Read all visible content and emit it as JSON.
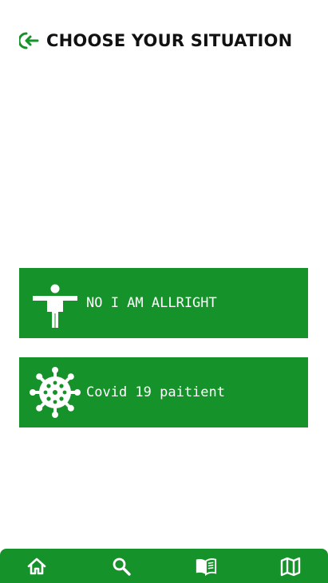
{
  "header": {
    "title": "CHOOSE YOUR SITUATION",
    "back_icon": "back-arrow-icon"
  },
  "options": [
    {
      "label": "NO I AM ALLRIGHT",
      "icon": "person-icon"
    },
    {
      "label": "Covid 19 paitient",
      "icon": "virus-icon"
    }
  ],
  "bottom_nav": {
    "items": [
      {
        "icon": "home-icon"
      },
      {
        "icon": "search-icon"
      },
      {
        "icon": "book-icon"
      },
      {
        "icon": "map-icon"
      }
    ]
  },
  "colors": {
    "accent": "#16922a",
    "text": "#111111",
    "background": "#ffffff"
  }
}
